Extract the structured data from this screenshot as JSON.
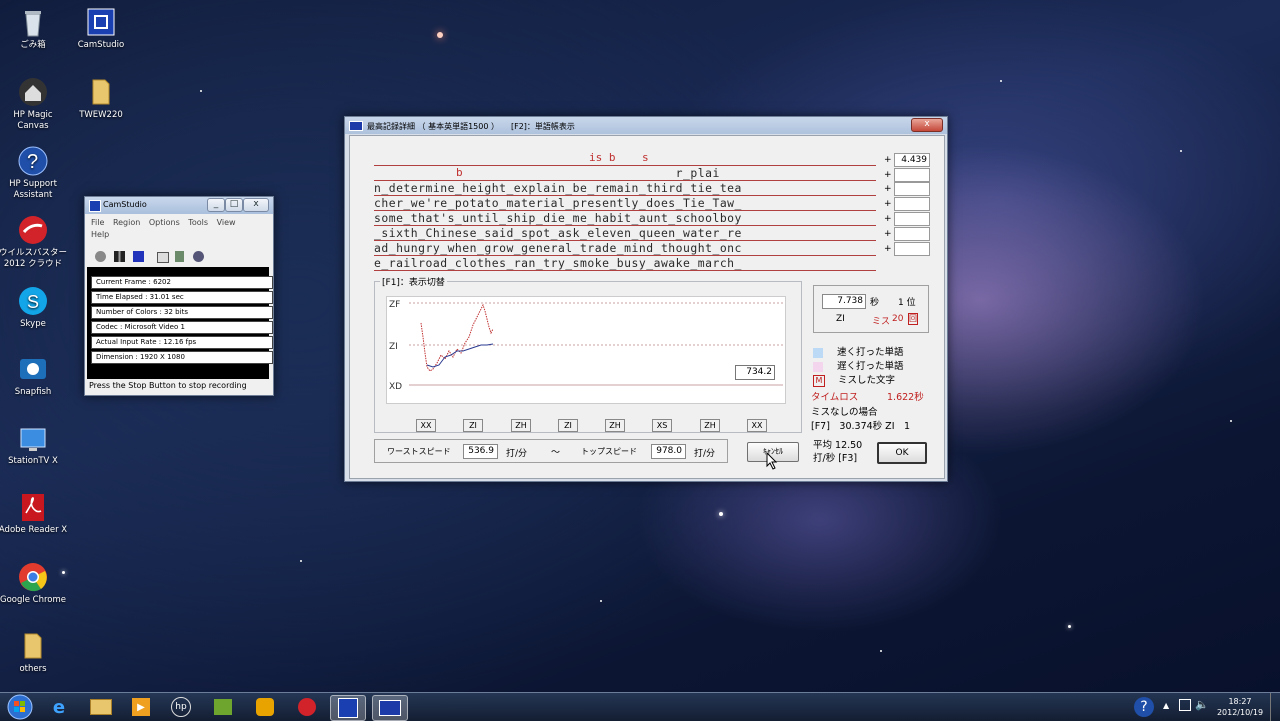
{
  "desktop": {
    "icons": [
      {
        "label": "ごみ箱"
      },
      {
        "label": "HP Magic Canvas"
      },
      {
        "label": "HP Support Assistant"
      },
      {
        "label": "ウイルスバスター 2012 クラウド"
      },
      {
        "label": "Skype"
      },
      {
        "label": "Snapfish"
      },
      {
        "label": "StationTV X"
      },
      {
        "label": "Adobe Reader X"
      },
      {
        "label": "Google Chrome"
      },
      {
        "label": "others"
      },
      {
        "label": "CamStudio"
      },
      {
        "label": "TWEW220"
      }
    ]
  },
  "main_window": {
    "title": "最高記録詳細 （ 基本英単語1500 ）　　[F2]：単語帳表示",
    "minimize": "_",
    "maximize": "□",
    "close": "x",
    "header_marks": "is b    s",
    "header_mark_b": "b",
    "plus": "+",
    "rows": [
      {
        "text": "                                         r_plai",
        "value": "4.439"
      },
      {
        "text": "n_determine_height_explain_be_remain_third_tie_tea",
        "value": ""
      },
      {
        "text": "cher_we're_potato_material_presently_does_Tie_Taw_",
        "value": ""
      },
      {
        "text": "some_that's_until_ship_die_me_habit_aunt_schoolboy",
        "value": ""
      },
      {
        "text": "_sixth_Chinese_said_spot_ask_eleven_queen_water_re",
        "value": ""
      },
      {
        "text": "ad_hungry_when_grow_general_trade_mind_thought_onc",
        "value": ""
      },
      {
        "text": "e_railroad_clothes_ran_try_smoke_busy_awake_march_",
        "value": ""
      }
    ],
    "graph": {
      "label": "[F1]：表示切替",
      "y_labels": [
        "ZF",
        "ZI",
        "XD"
      ],
      "value": "734.2",
      "x_ranks": [
        "XX",
        "ZI",
        "ZH",
        "ZI",
        "ZH",
        "XS",
        "ZH",
        "XX"
      ]
    },
    "result": {
      "time": "7.738",
      "time_unit": "秒",
      "rank": "1 位",
      "grade": "ZI",
      "miss_label": "ミス",
      "miss_count": "20",
      "miss_unit": "回"
    },
    "legend": {
      "fast": "速く打った単語",
      "slow": "遅く打った単語",
      "miss_marker": "M",
      "miss": "ミスした文字",
      "fast_color": "#bcd9f5",
      "slow_color": "#f3d6ee"
    },
    "timeloss_label": "タイムロス",
    "timeloss_value": "1.622秒",
    "nomiss_label": "ミスなしの場合",
    "nomiss_value": "[F7]　30.374秒 ZI　1",
    "speed": {
      "worst_label": "ワーストスピード",
      "worst_value": "536.9",
      "unit": "打/分",
      "tilde": "～",
      "top_label": "トップスピード",
      "top_value": "978.0"
    },
    "avg_line1": "平均 12.50",
    "avg_line2": "打/秒 [F3]",
    "cancel_button": "ｷｬﾝｾﾙ",
    "ok_button": "OK"
  },
  "camstudio": {
    "title": "CamStudio",
    "menu": [
      "File",
      "Region",
      "Options",
      "Tools",
      "View",
      "Help"
    ],
    "stats": [
      "Current Frame : 6202",
      "Time Elapsed : 31.01 sec",
      "Number of Colors : 32 bits",
      "Codec : Microsoft Video 1",
      "Actual Input Rate : 12.16 fps",
      "Dimension : 1920 X 1080"
    ],
    "status": "Press the Stop Button to stop recording"
  },
  "taskbar": {
    "time": "18:27",
    "date": "2012/10/19"
  }
}
